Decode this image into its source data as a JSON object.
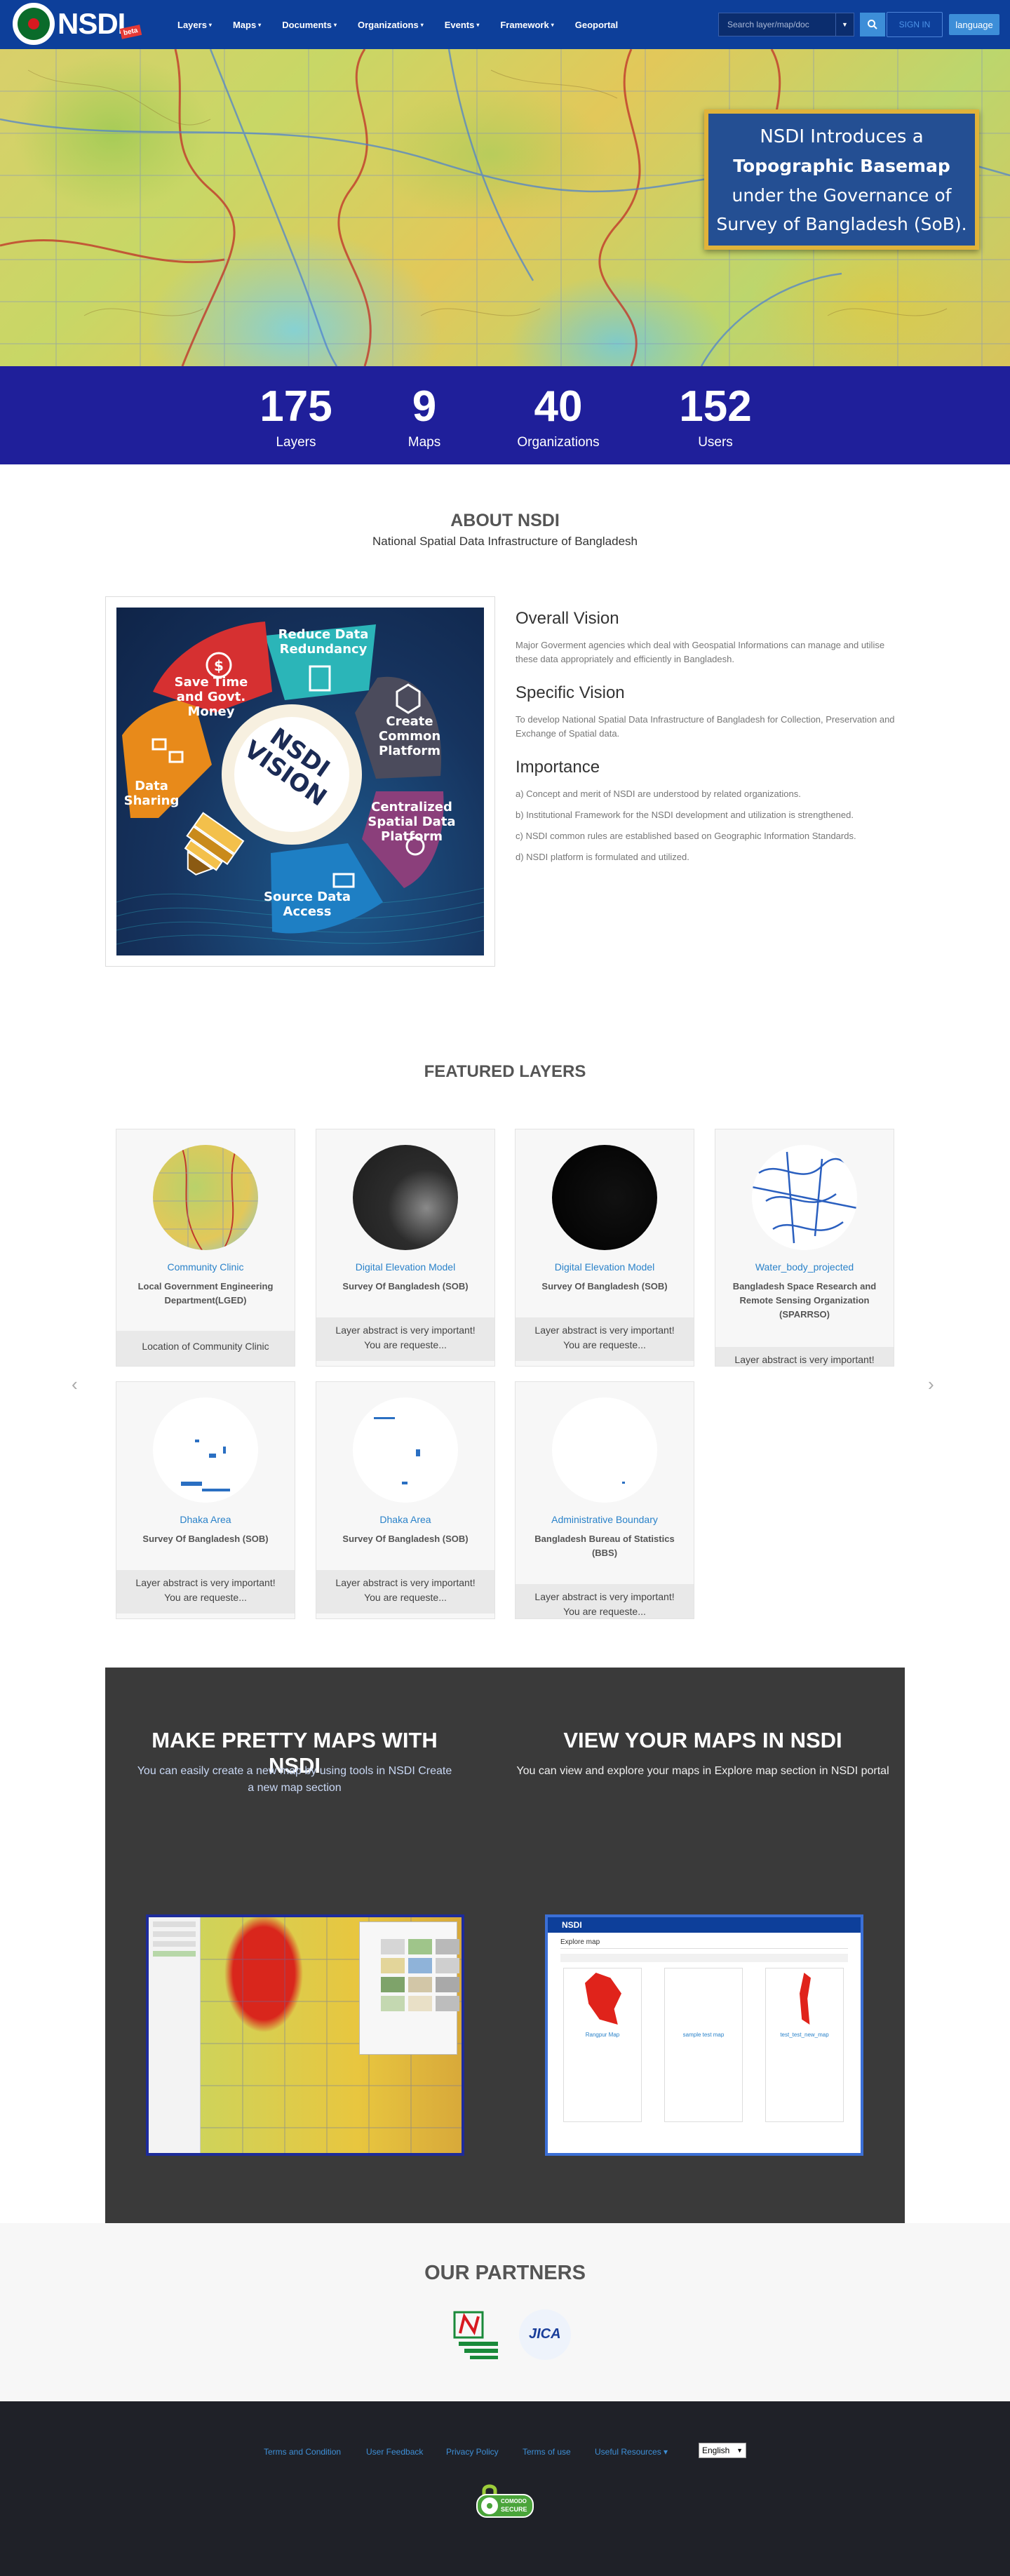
{
  "brand": {
    "name": "NSDI",
    "badge": "beta"
  },
  "nav": {
    "items": [
      {
        "label": "Layers",
        "dropdown": true
      },
      {
        "label": "Maps",
        "dropdown": true
      },
      {
        "label": "Documents",
        "dropdown": true
      },
      {
        "label": "Organizations",
        "dropdown": true
      },
      {
        "label": "Events",
        "dropdown": true
      },
      {
        "label": "Framework",
        "dropdown": true
      },
      {
        "label": "Geoportal",
        "dropdown": false
      }
    ],
    "search_placeholder": "Search layer/map/doc",
    "signin_label": "SIGN IN",
    "language_label": "language"
  },
  "hero": {
    "banner_line1": "NSDI Introduces a",
    "banner_line2": "Topographic Basemap",
    "banner_line3": "under the Governance of",
    "banner_line4": "Survey of Bangladesh (SoB)."
  },
  "stats": [
    {
      "value": "175",
      "label": "Layers"
    },
    {
      "value": "9",
      "label": "Maps"
    },
    {
      "value": "40",
      "label": "Organizations"
    },
    {
      "value": "152",
      "label": "Users"
    }
  ],
  "about": {
    "title": "ABOUT NSDI",
    "subtitle": "National Spatial Data Infrastructure of Bangladesh",
    "vision": {
      "center": "NSDI VISION",
      "petal_reduce": "Reduce Data Redundancy",
      "petal_create": "Create Common Platform",
      "petal_centralized": "Centralized Spatial Data Platform",
      "petal_source": "Source Data Access",
      "petal_sharing": "Data Sharing",
      "petal_save": "Save Time and Govt. Money"
    },
    "overall_title": "Overall Vision",
    "overall_text": "Major Goverment agencies which deal with Geospatial Informations can manage and utilise these data appropriately and efficiently in Bangladesh.",
    "specific_title": "Specific Vision",
    "specific_text": "To develop National Spatial Data Infrastructure of Bangladesh for Collection, Preservation and Exchange of Spatial data.",
    "importance_title": "Importance",
    "importance_items": [
      "a) Concept and merit of NSDI are understood by related organizations.",
      "b) Institutional Framework for the NSDI development and utilization is strengthened.",
      "c) NSDI common rules are established based on Geographic Information Standards.",
      "d) NSDI platform is formulated and utilized."
    ]
  },
  "featured": {
    "title": "FEATURED LAYERS",
    "prev_icon": "chevron-left-icon",
    "next_icon": "chevron-right-icon",
    "cards": [
      {
        "name": "Community Clinic",
        "org": "Local Government Engineering Department(LGED)",
        "abstract1": "Location of Community Clinic",
        "abstract2": ""
      },
      {
        "name": "Digital Elevation Model",
        "org": "Survey Of Bangladesh (SOB)",
        "abstract1": "Layer abstract is very important!",
        "abstract2": "You are requeste..."
      },
      {
        "name": "Digital Elevation Model",
        "org": "Survey Of Bangladesh (SOB)",
        "abstract1": "Layer abstract is very important!",
        "abstract2": "You are requeste..."
      },
      {
        "name": "Water_body_projected",
        "org": "Bangladesh Space Research and Remote Sensing Organization (SPARRSO)",
        "abstract1": "Layer abstract is very important!",
        "abstract2": ""
      },
      {
        "name": "Dhaka Area",
        "org": "Survey Of Bangladesh (SOB)",
        "abstract1": "Layer abstract is very important!",
        "abstract2": "You are requeste..."
      },
      {
        "name": "Dhaka Area",
        "org": "Survey Of Bangladesh (SOB)",
        "abstract1": "Layer abstract is very important!",
        "abstract2": "You are requeste..."
      },
      {
        "name": "Administrative Boundary",
        "org": "Bangladesh Bureau of Statistics (BBS)",
        "abstract1": "Layer abstract is very important!",
        "abstract2": "You are requeste..."
      }
    ]
  },
  "maps_section": {
    "make_title": "MAKE PRETTY MAPS WITH NSDI",
    "make_text": "You can easily create a new map by using tools in NSDI Create a new map section",
    "view_title": "VIEW YOUR MAPS IN NSDI",
    "view_text": "You can view and explore your maps in Explore map section in NSDI portal",
    "view_shot": {
      "brand": "NSDI",
      "heading": "Explore map",
      "sample_maps": [
        "Rangpur Map",
        "sample test map",
        "test_test_new_map"
      ]
    }
  },
  "partners": {
    "title": "OUR PARTNERS",
    "logos": [
      "lged-logo",
      "jica-logo"
    ],
    "jica_label": "JICA"
  },
  "footer": {
    "links": [
      "Terms and Condition",
      "User Feedback",
      "Privacy Policy",
      "Terms of use",
      "Useful Resources"
    ],
    "language": "English",
    "secure_label_top": "COMODO",
    "secure_label_bottom": "SECURE"
  },
  "colors": {
    "nav_bg": "#0d3f9a",
    "stats_bg": "#1f1f9a",
    "accent": "#3d8ed8",
    "footer_bg": "#1f2128",
    "banner_border": "#e0b33a"
  }
}
